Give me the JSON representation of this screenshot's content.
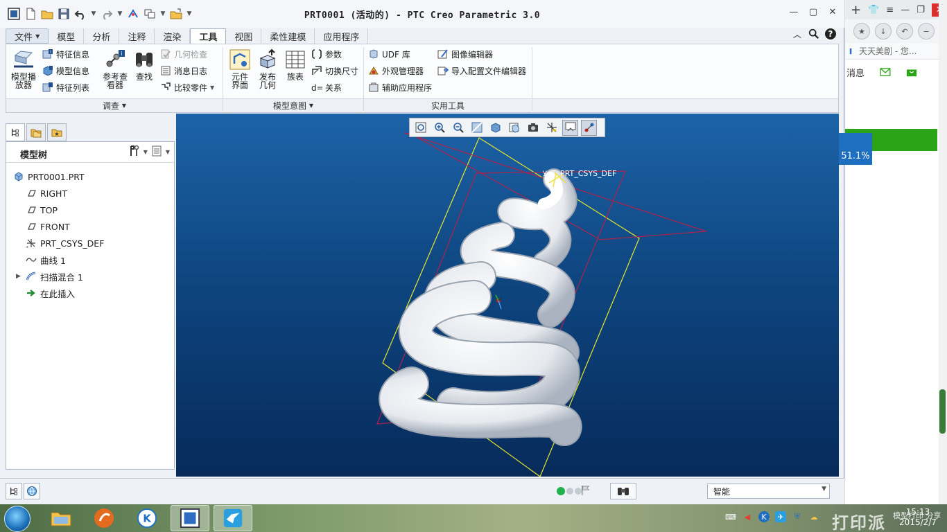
{
  "window": {
    "title": "PRT0001 (活动的) - PTC Creo Parametric 3.0"
  },
  "ribbon_tabs": [
    {
      "label": "文件",
      "active": false
    },
    {
      "label": "模型",
      "active": false
    },
    {
      "label": "分析",
      "active": false
    },
    {
      "label": "注释",
      "active": false
    },
    {
      "label": "渲染",
      "active": false
    },
    {
      "label": "工具",
      "active": true
    },
    {
      "label": "视图",
      "active": false
    },
    {
      "label": "柔性建模",
      "active": false
    },
    {
      "label": "应用程序",
      "active": false
    }
  ],
  "ribbon": {
    "investigate": {
      "group_label": "调查",
      "model_player": "模型播放器",
      "model_player_l1": "模型播",
      "model_player_l2": "放器",
      "feature_info": "特征信息",
      "model_info": "模型信息",
      "feature_list": "特征列表",
      "ref_viewer_l1": "参考查",
      "ref_viewer_l2": "看器",
      "find": "查找",
      "geom_check": "几何检查",
      "message_log": "消息日志",
      "compare_part": "比较零件"
    },
    "model_intent": {
      "group_label": "模型意图",
      "component_l1": "元件",
      "component_l2": "界面",
      "publish_l1": "发布",
      "publish_l2": "几何",
      "family_table": "族表",
      "parameters": "参数",
      "switch_dims": "切换尺寸",
      "relations": "关系"
    },
    "utilities": {
      "group_label": "实用工具",
      "udf_library": "UDF 库",
      "appearance_manager": "外观管理器",
      "aux_apps": "辅助应用程序",
      "image_editor": "图像编辑器",
      "config_editor": "导入配置文件编辑器"
    }
  },
  "model_tree": {
    "title": "模型树",
    "items": [
      {
        "label": "PRT0001.PRT",
        "icon": "part-icon"
      },
      {
        "label": "RIGHT",
        "icon": "datum-plane-icon"
      },
      {
        "label": "TOP",
        "icon": "datum-plane-icon"
      },
      {
        "label": "FRONT",
        "icon": "datum-plane-icon"
      },
      {
        "label": "PRT_CSYS_DEF",
        "icon": "csys-icon"
      },
      {
        "label": "曲线 1",
        "icon": "curve-icon"
      },
      {
        "label": "扫描混合 1",
        "icon": "swept-blend-icon"
      },
      {
        "label": "在此插入",
        "icon": "insert-here-icon"
      }
    ]
  },
  "viewport": {
    "csys_label": "PRT_CSYS_DEF",
    "csys_axis": "y"
  },
  "status_bar": {
    "filter_value": "智能"
  },
  "browser": {
    "bookmark": "天天美剧 - 您...",
    "message_label": "消息",
    "percent": "51.1%"
  },
  "taskbar": {
    "time": "15:13",
    "date": "2015/2/7",
    "watermark": "打印派",
    "watermark_sub": "模型打印 分享"
  },
  "colors": {
    "viewport_top": "#1d63a8",
    "viewport_bottom": "#072a5a",
    "datum_yellow": "#e8e82a",
    "datum_red": "#b0224a",
    "browser_green": "#2ba316"
  }
}
